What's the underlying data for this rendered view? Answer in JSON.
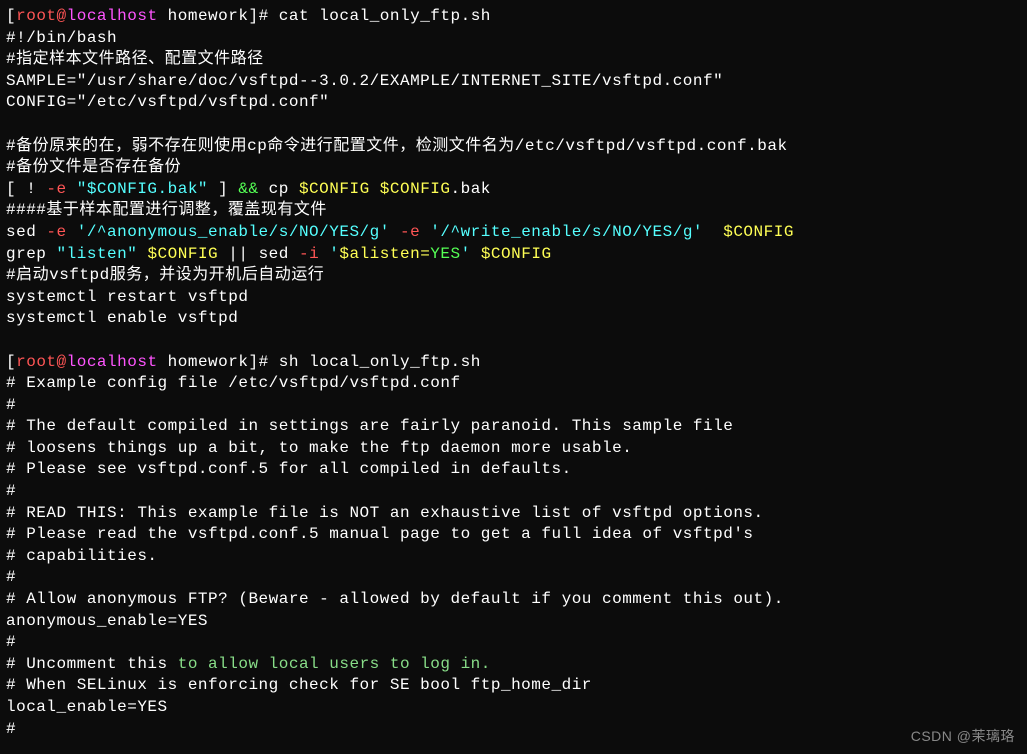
{
  "prompt1": {
    "bracket_open": "[",
    "user": "root@",
    "host": "localhost",
    "dir": " homework",
    "bracket_close": "]#",
    "cmd": " cat local_only_ftp.sh"
  },
  "script": {
    "shebang": "#!/bin/bash",
    "comment1": "#指定样本文件路径、配置文件路径",
    "sample_line": "SAMPLE=\"/usr/share/doc/vsftpd--3.0.2/EXAMPLE/INTERNET_SITE/vsftpd.conf\"",
    "config_line": "CONFIG=\"/etc/vsftpd/vsftpd.conf\"",
    "blank1": "",
    "comment2": "#备份原来的在，弱不存在则使用cp命令进行配置文件，检测文件名为/etc/vsftpd/vsftpd.conf.bak",
    "comment3": "#备份文件是否存在备份",
    "test_open": "[ ! ",
    "test_flag": "-e",
    "test_str": " \"$CONFIG.bak\"",
    "test_close": " ] ",
    "test_and": "&&",
    "test_cp": " cp ",
    "test_var1": "$CONFIG",
    "test_space": " ",
    "test_var2": "$CONFIG",
    "test_bak": ".bak",
    "comment4": "####基于样本配置进行调整，覆盖现有文件",
    "sed1_cmd": "sed ",
    "sed1_flag1": "-e",
    "sed1_str1": " '/^anonymous_enable/s/NO/YES/g'",
    "sed1_flag2": " -e",
    "sed1_str2": " '/^write_enable/s/NO/YES/g'",
    "sed1_space": "  ",
    "sed1_var": "$CONFIG",
    "grep_cmd": "grep ",
    "grep_str": "\"listen\"",
    "grep_space1": " ",
    "grep_var1": "$CONFIG",
    "grep_pipe": " || ",
    "grep_sed": "sed ",
    "grep_flag": "-i",
    "grep_q1": " '",
    "grep_listen": "$alisten=",
    "grep_yes": "YES",
    "grep_q2": "'",
    "grep_space2": " ",
    "grep_var2": "$CONFIG",
    "comment5": "#启动vsftpd服务，并设为开机后自动运行",
    "sys1": "systemctl restart vsftpd",
    "sys2": "systemctl enable vsftpd"
  },
  "prompt2": {
    "bracket_open": "[",
    "user": "root@",
    "host": "localhost",
    "dir": " homework",
    "bracket_close": "]#",
    "cmd": " sh local_only_ftp.sh"
  },
  "output": {
    "l1": "# Example config file /etc/vsftpd/vsftpd.conf",
    "l2": "#",
    "l3": "# The default compiled in settings are fairly paranoid. This sample file",
    "l4": "# loosens things up a bit, to make the ftp daemon more usable.",
    "l5": "# Please see vsftpd.conf.5 for all compiled in defaults.",
    "l6": "#",
    "l7": "# READ THIS: This example file is NOT an exhaustive list of vsftpd options.",
    "l8": "# Please read the vsftpd.conf.5 manual page to get a full idea of vsftpd's",
    "l9": "# capabilities.",
    "l10": "#",
    "l11": "# Allow anonymous FTP? (Beware - allowed by default if you comment this out).",
    "l12": "anonymous_enable=YES",
    "l13": "#",
    "l14a": "# Uncomment this ",
    "l14b": "to allow local users to log in.",
    "l15": "# When SELinux is enforcing check for SE bool ftp_home_dir",
    "l16": "local_enable=YES",
    "l17": "#"
  },
  "watermark": "CSDN @茉璃珞"
}
